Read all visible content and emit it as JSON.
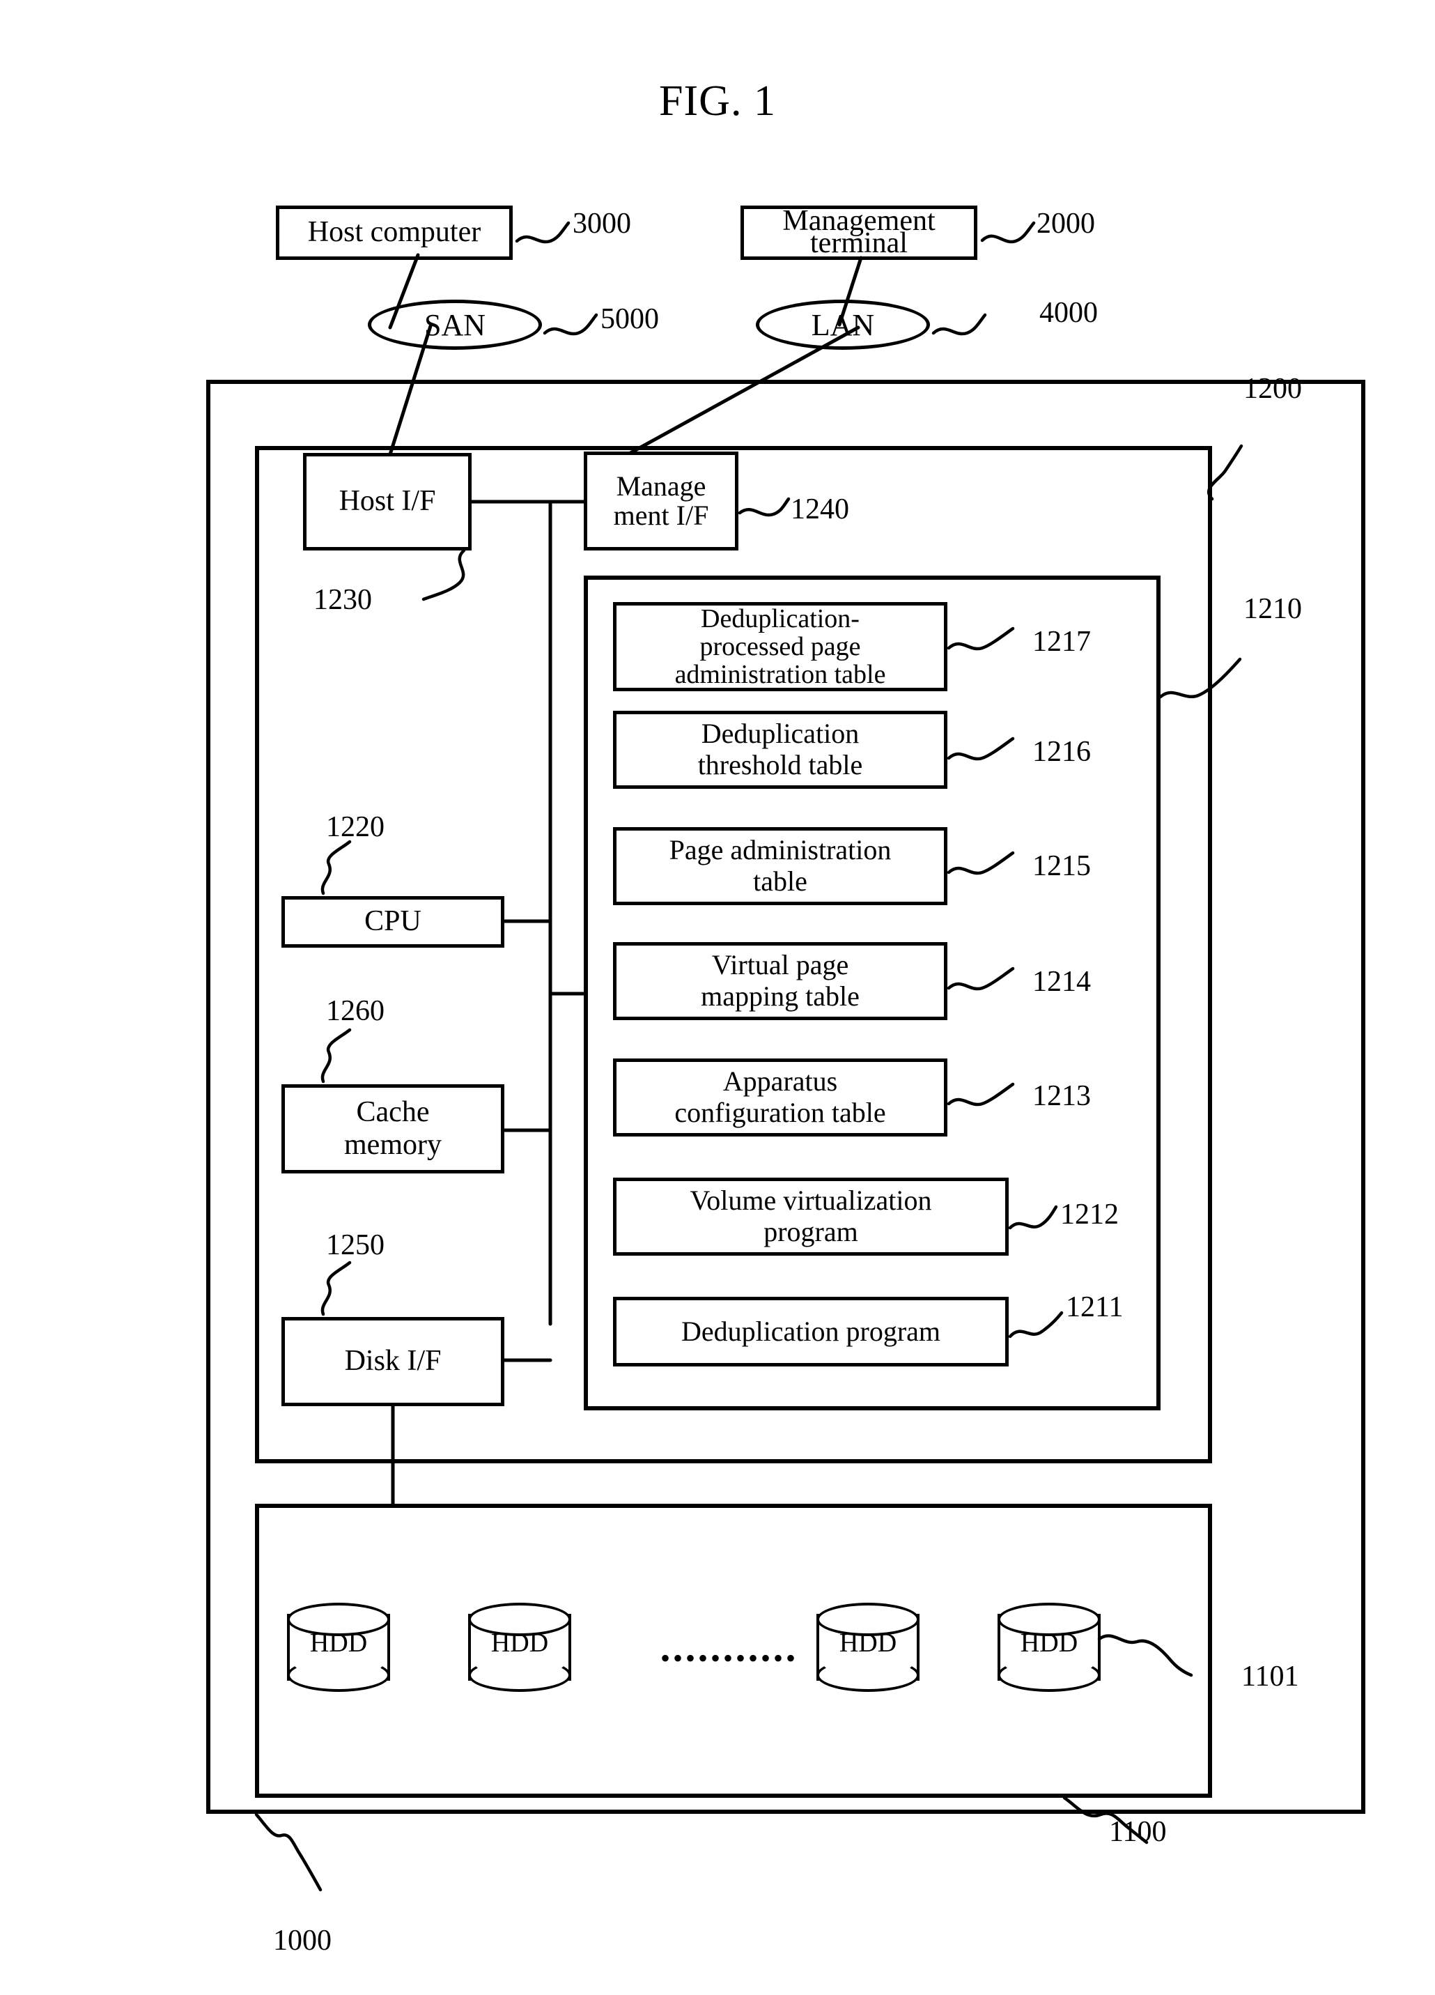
{
  "figure": {
    "title": "FIG. 1"
  },
  "external": {
    "host_computer": {
      "label": "Host computer",
      "ref": "3000"
    },
    "management_terminal": {
      "label_line1": "Management",
      "label_line2": "terminal",
      "ref": "2000"
    },
    "san": {
      "label": "SAN",
      "ref": "5000"
    },
    "lan": {
      "label": "LAN",
      "ref": "4000"
    }
  },
  "storage_system": {
    "ref": "1000",
    "controller": {
      "ref": "1200",
      "host_if": {
        "label": "Host I/F",
        "ref": "1230"
      },
      "management_if": {
        "label_line1": "Manage",
        "label_line2": "ment I/F",
        "ref": "1240"
      },
      "cpu": {
        "label": "CPU",
        "ref": "1220"
      },
      "cache_memory": {
        "label_line1": "Cache",
        "label_line2": "memory",
        "ref": "1260"
      },
      "disk_if": {
        "label": "Disk I/F",
        "ref": "1250"
      },
      "memory": {
        "ref": "1210",
        "items": [
          {
            "label_line1": "Deduplication-",
            "label_line2": "processed page",
            "label_line3": "administration  table",
            "ref": "1217"
          },
          {
            "label_line1": "Deduplication",
            "label_line2": "threshold table",
            "ref": "1216"
          },
          {
            "label_line1": "Page administration",
            "label_line2": "table",
            "ref": "1215"
          },
          {
            "label_line1": "Virtual page",
            "label_line2": "mapping table",
            "ref": "1214"
          },
          {
            "label_line1": "Apparatus",
            "label_line2": "configuration table",
            "ref": "1213"
          },
          {
            "label_line1": "Volume virtualization",
            "label_line2": "program",
            "ref": "1212"
          },
          {
            "label_line1": "Deduplication program",
            "label_line2": "",
            "ref": "1211"
          }
        ]
      }
    },
    "disk_unit": {
      "ref": "1100",
      "drive_ref": "1101",
      "drives": [
        {
          "label": "HDD"
        },
        {
          "label": "HDD"
        },
        {
          "label": "HDD"
        },
        {
          "label": "HDD"
        }
      ],
      "ellipsis": "•••••••••••"
    }
  }
}
